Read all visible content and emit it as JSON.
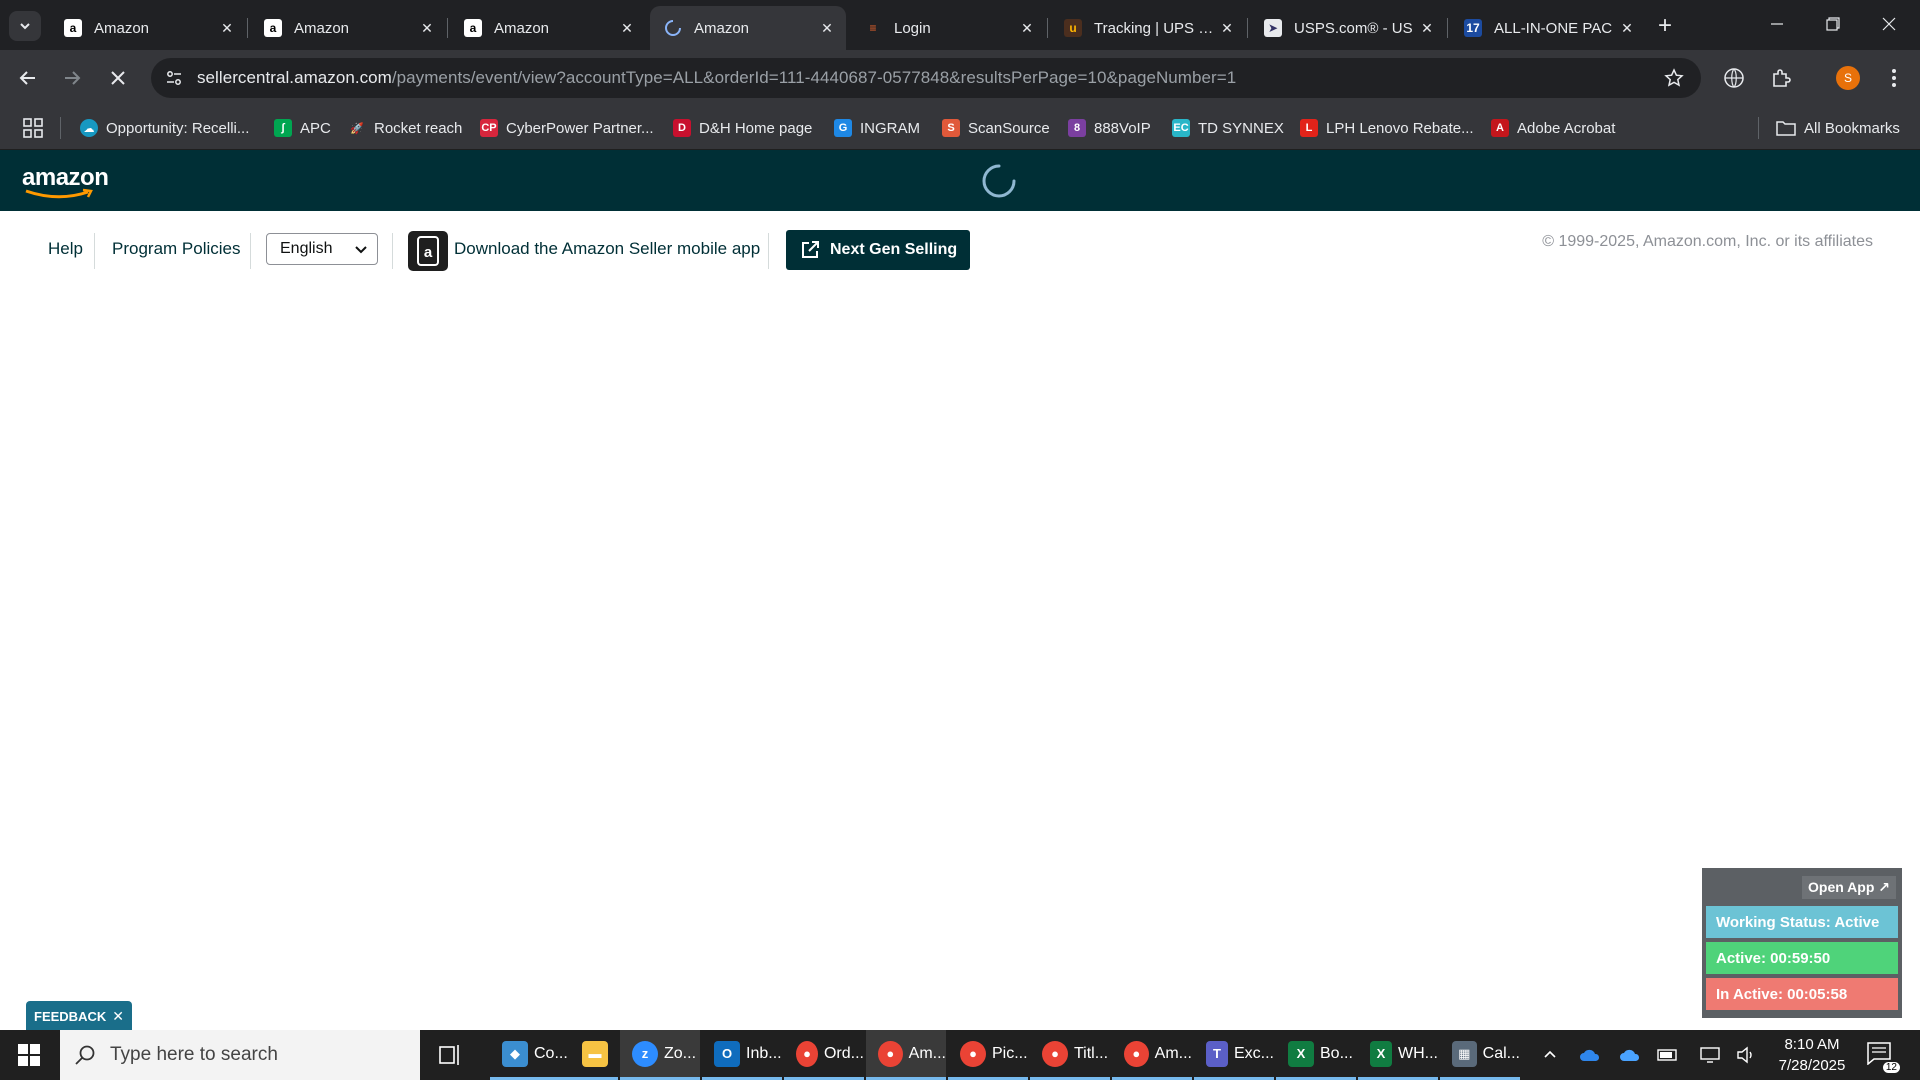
{
  "browser": {
    "tabs": [
      {
        "title": "Amazon",
        "icon": "amazon-icon"
      },
      {
        "title": "Amazon",
        "icon": "amazon-icon"
      },
      {
        "title": "Amazon",
        "icon": "amazon-icon"
      },
      {
        "title": "Amazon",
        "icon": "loading-icon",
        "active": true
      },
      {
        "title": "Login",
        "icon": "login-icon"
      },
      {
        "title": "Tracking | UPS - U",
        "icon": "ups-icon"
      },
      {
        "title": "USPS.com® - US",
        "icon": "usps-icon"
      },
      {
        "title": "ALL-IN-ONE PAC",
        "icon": "17track-icon"
      }
    ],
    "url_host": "sellercentral.amazon.com",
    "url_path": "/payments/event/view?accountType=ALL&orderId=111-4440687-0577848&resultsPerPage=10&pageNumber=1",
    "profile_initial": "S",
    "bookmarks": [
      {
        "label": "Opportunity: Recelli...",
        "color": "#1798c1"
      },
      {
        "label": "APC",
        "color": "#00a651"
      },
      {
        "label": "Rocket reach",
        "color": "#6a7cff"
      },
      {
        "label": "CyberPower Partner...",
        "color": "#d7263d"
      },
      {
        "label": "D&H Home page",
        "color": "#c8102e"
      },
      {
        "label": "INGRAM",
        "color": "#1e88e5"
      },
      {
        "label": "ScanSource",
        "color": "#e0593a"
      },
      {
        "label": "888VoIP",
        "color": "#7b3fa0"
      },
      {
        "label": "TD SYNNEX",
        "color": "#29b6c8"
      },
      {
        "label": "LPH Lenovo Rebate...",
        "color": "#e2231a"
      },
      {
        "label": "Adobe Acrobat",
        "color": "#c4161c"
      }
    ],
    "all_bookmarks_label": "All Bookmarks"
  },
  "amazon": {
    "logo": "amazon",
    "footer": {
      "help": "Help",
      "program_policies": "Program Policies",
      "language": "English",
      "app_link": "Download the Amazon Seller mobile app",
      "next_gen_button": "Next Gen Selling",
      "copyright": "© 1999-2025, Amazon.com, Inc. or its affiliates"
    }
  },
  "tracker": {
    "open_app": "Open App ↗",
    "working_status": "Working Status: Active",
    "active": "Active: 00:59:50",
    "inactive": "In Active: 00:05:58",
    "colors": {
      "status": "#6cc3d5",
      "active": "#4fd37a",
      "inactive": "#ef7a72"
    }
  },
  "feedback": {
    "label": "FEEDBACK",
    "close": "✕"
  },
  "taskbar": {
    "search_placeholder": "Type here to search",
    "apps": [
      {
        "label": "Co...",
        "color": "#3b8ed0"
      },
      {
        "label": "",
        "color": "#f6c343"
      },
      {
        "label": "Zo...",
        "color": "#2d8cff"
      },
      {
        "label": "Inb...",
        "color": "#0f6cbd"
      },
      {
        "label": "Ord...",
        "color": "#ea4335"
      },
      {
        "label": "Am...",
        "color": "#ea4335"
      },
      {
        "label": "Pic...",
        "color": "#ea4335"
      },
      {
        "label": "Titl...",
        "color": "#ea4335"
      },
      {
        "label": "Am...",
        "color": "#ea4335"
      },
      {
        "label": "Exc...",
        "color": "#5b5fc7"
      },
      {
        "label": "Bo...",
        "color": "#107c41"
      },
      {
        "label": "WH...",
        "color": "#107c41"
      },
      {
        "label": "Cal...",
        "color": "#5a6a7a"
      }
    ],
    "time": "8:10 AM",
    "date": "7/28/2025",
    "notification_count": "12"
  }
}
